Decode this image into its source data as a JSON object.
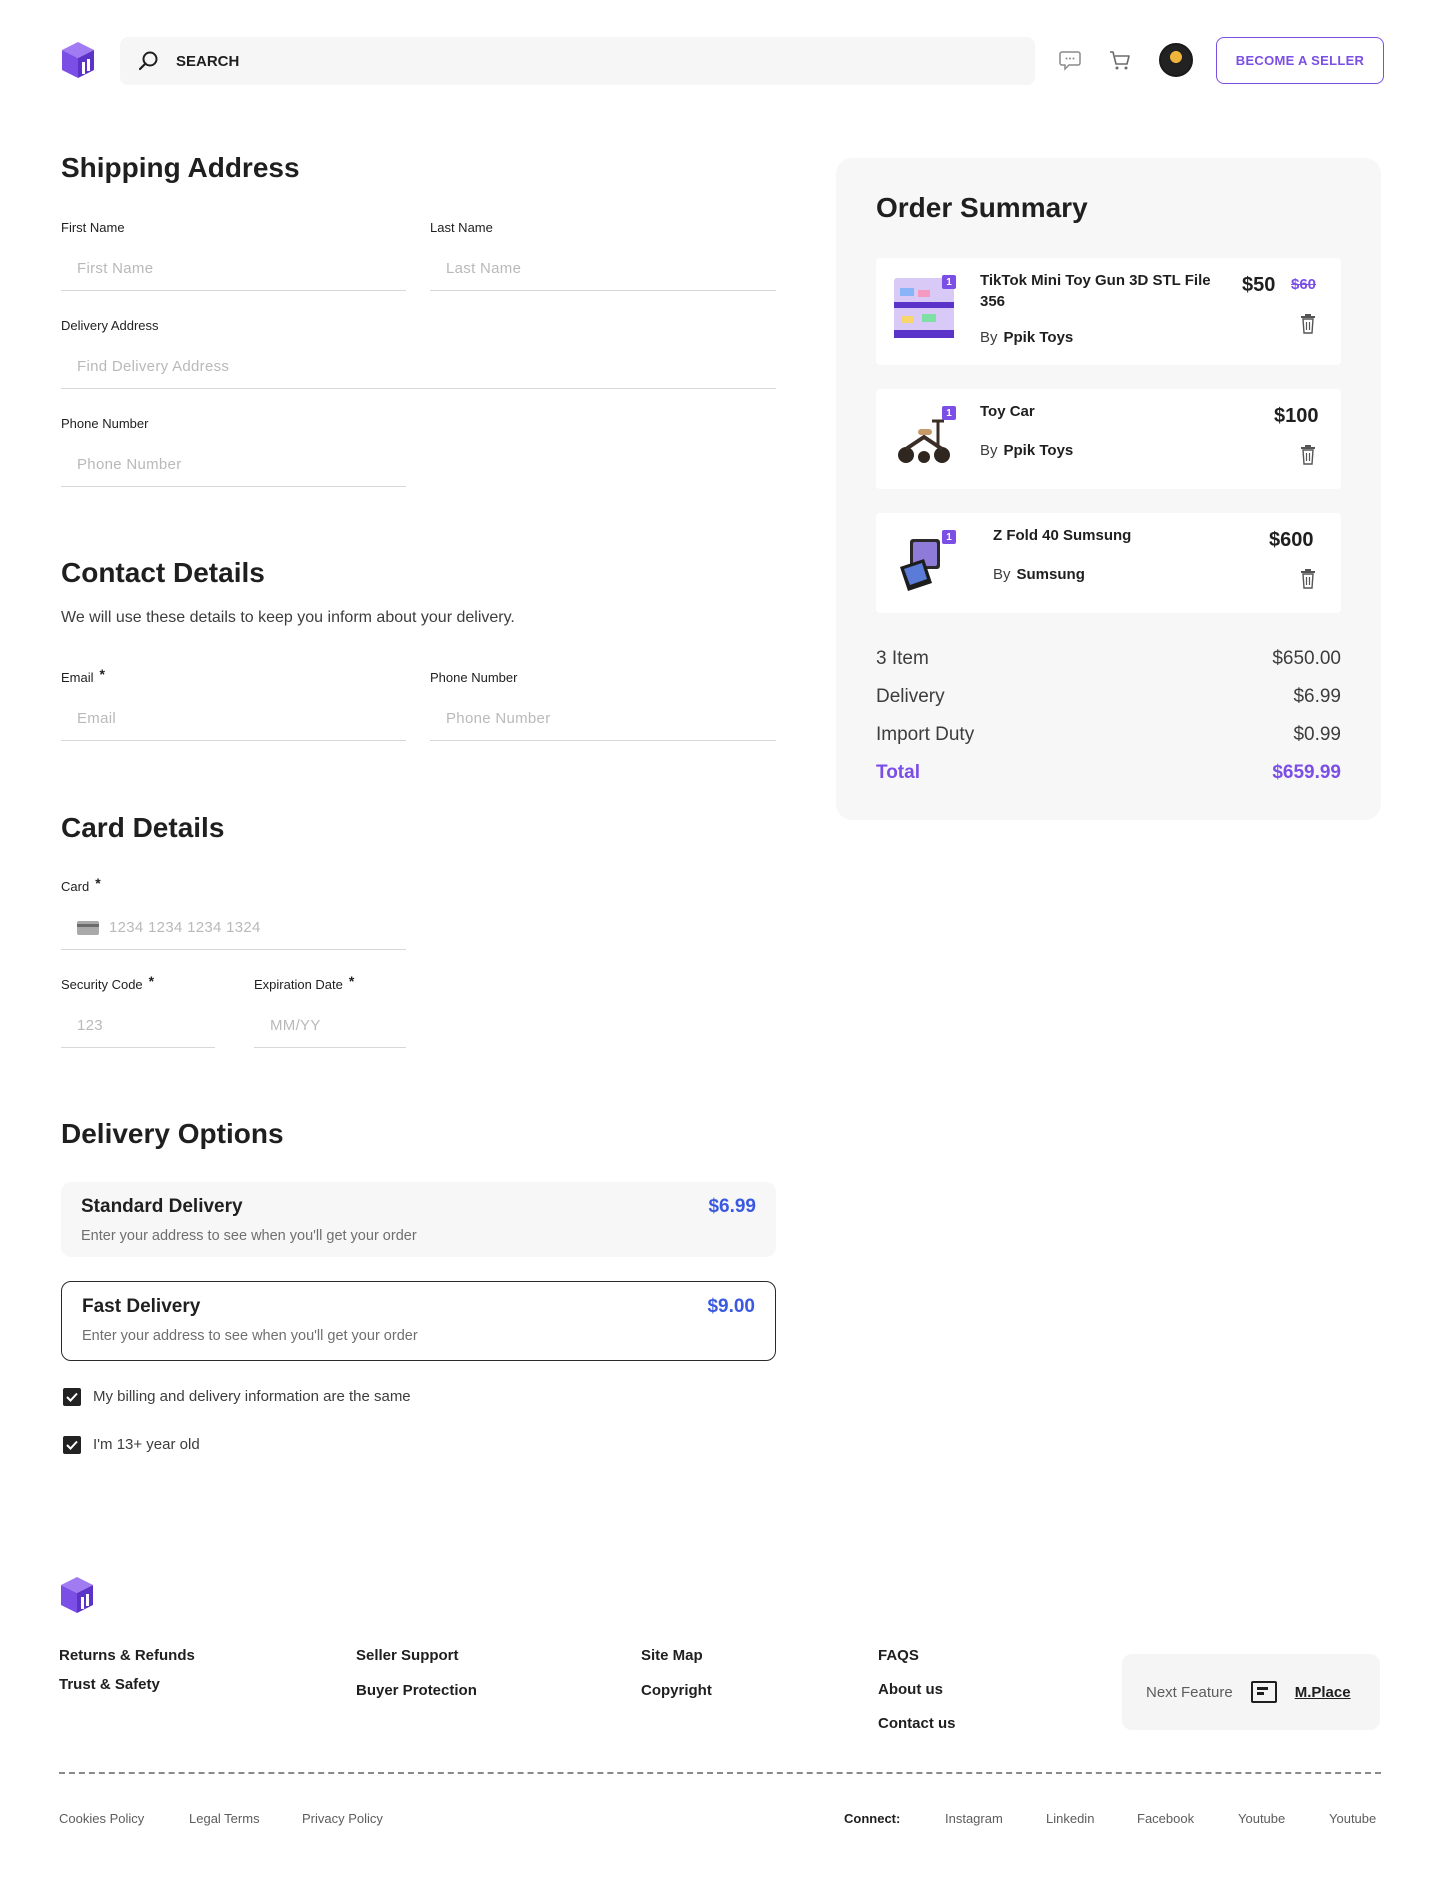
{
  "header": {
    "search_placeholder": "SEARCH",
    "seller_button": "BECOME A SELLER"
  },
  "shipping": {
    "title": "Shipping Address",
    "first_name_label": "First Name",
    "first_name_placeholder": "First Name",
    "last_name_label": "Last Name",
    "last_name_placeholder": "Last Name",
    "delivery_label": "Delivery Address",
    "delivery_placeholder": "Find Delivery Address",
    "phone_label": "Phone Number",
    "phone_placeholder": "Phone Number"
  },
  "contact": {
    "title": "Contact Details",
    "subtitle": "We will use these details to keep you inform about your delivery.",
    "email_label": "Email",
    "email_placeholder": "Email",
    "phone_label": "Phone Number",
    "phone_placeholder": "Phone Number",
    "required_mark": "*"
  },
  "card": {
    "title": "Card Details",
    "card_label": "Card",
    "card_placeholder": "1234 1234 1234 1324",
    "security_label": "Security Code",
    "security_placeholder": "123",
    "expiry_label": "Expiration Date",
    "expiry_placeholder": "MM/YY"
  },
  "delivery": {
    "title": "Delivery Options",
    "options": [
      {
        "title": "Standard Delivery",
        "desc": "Enter your address to see when you'll get your order",
        "price": "$6.99",
        "selected": false
      },
      {
        "title": "Fast Delivery",
        "desc": "Enter your address to see when you'll get your order",
        "price": "$9.00",
        "selected": true
      }
    ],
    "checkboxes": [
      {
        "label": "My billing and delivery information are the same",
        "checked": true
      },
      {
        "label": "I'm 13+ year old",
        "checked": true
      }
    ]
  },
  "summary": {
    "title": "Order Summary",
    "items": [
      {
        "name": "TikTok Mini Toy Gun 3D STL File 356",
        "by_label": "By",
        "seller": "Ppik Toys",
        "price": "$50",
        "old_price": "$60",
        "qty": "1"
      },
      {
        "name": "Toy Car",
        "by_label": "By",
        "seller": "Ppik Toys",
        "price": "$100",
        "qty": "1"
      },
      {
        "name": "Z Fold 40 Sumsung",
        "by_label": "By",
        "seller": "Sumsung",
        "price": "$600",
        "qty": "1"
      }
    ],
    "rows": [
      {
        "label": "3 Item",
        "value": "$650.00"
      },
      {
        "label": "Delivery",
        "value": "$6.99"
      },
      {
        "label": "Import Duty",
        "value": "$0.99"
      }
    ],
    "total_label": "Total",
    "total_value": "$659.99"
  },
  "footer": {
    "col1": [
      "Returns & Refunds",
      "Trust & Safety"
    ],
    "col2": [
      "Seller Support",
      "Buyer Protection"
    ],
    "col3": [
      "Site Map",
      "Copyright"
    ],
    "col4": [
      "FAQS",
      "About us",
      "Contact us"
    ],
    "next_feature_label": "Next Feature",
    "next_feature_link": "M.Place",
    "legal": [
      "Cookies Policy",
      "Legal Terms",
      "Privacy Policy"
    ],
    "connect_label": "Connect:",
    "social": [
      "Instagram",
      "Linkedin",
      "Facebook",
      "Youtube",
      "Youtube"
    ]
  },
  "colors": {
    "accent": "#7b4fe6",
    "price_blue": "#3a59e0"
  }
}
